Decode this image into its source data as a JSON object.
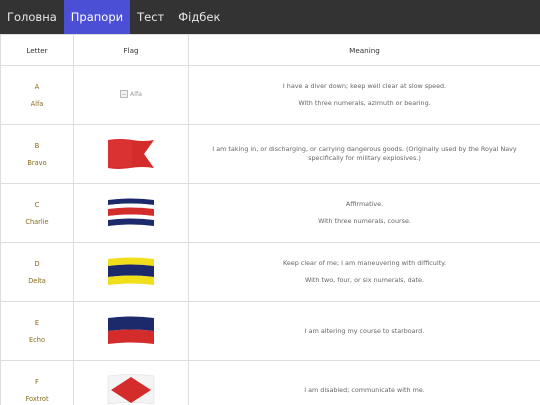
{
  "nav": {
    "items": [
      {
        "label": "Головна"
      },
      {
        "label": "Прапори"
      },
      {
        "label": "Тест"
      },
      {
        "label": "Фідбек"
      }
    ],
    "active_index": 1,
    "active_color": "#4b4fd6",
    "bar_color": "#333333"
  },
  "table": {
    "headers": {
      "letter": "Letter",
      "flag": "Flag",
      "meaning": "Meaning"
    },
    "rows": [
      {
        "letter": "A",
        "word": "Alfa",
        "flag_alt": "Alfa",
        "flag_icon": "alfa-flag-broken-image",
        "meaning": [
          "I have a diver down; keep well clear at slow speed.",
          "With three numerals, azimuth or bearing."
        ]
      },
      {
        "letter": "B",
        "word": "Bravo",
        "flag_icon": "bravo-flag",
        "meaning": [
          "I am taking in, or discharging, or carrying dangerous goods. (Originally used by the Royal Navy specifically for military explosives.)"
        ]
      },
      {
        "letter": "C",
        "word": "Charlie",
        "flag_icon": "charlie-flag",
        "meaning": [
          "Affirmative.",
          "With three numerals, course."
        ]
      },
      {
        "letter": "D",
        "word": "Delta",
        "flag_icon": "delta-flag",
        "meaning": [
          "Keep clear of me; I am maneuvering with difficulty.",
          "With two, four, or six numerals, date."
        ]
      },
      {
        "letter": "E",
        "word": "Echo",
        "flag_icon": "echo-flag",
        "meaning": [
          "I am altering my course to starboard."
        ]
      },
      {
        "letter": "F",
        "word": "Foxtrot",
        "flag_icon": "foxtrot-flag",
        "meaning": [
          "I am disabled; communicate with me."
        ]
      }
    ]
  },
  "colors": {
    "letter_text": "#8a6a1a",
    "border": "#dddddd",
    "flag_red": "#d42b2b",
    "flag_blue": "#1c2a6b",
    "flag_yellow": "#f2df1b"
  }
}
